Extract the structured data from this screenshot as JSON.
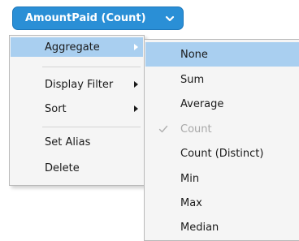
{
  "field_pill": {
    "label": "AmountPaid (Count)",
    "icon": "chevron-down-icon",
    "color": "#2a8fd6"
  },
  "context_menu": {
    "items": [
      {
        "label": "Aggregate",
        "has_submenu": true,
        "active": true
      },
      {
        "label": "Display Filter",
        "has_submenu": true
      },
      {
        "label": "Sort",
        "has_submenu": true
      },
      {
        "label": "Set Alias",
        "has_submenu": false
      },
      {
        "label": "Delete",
        "has_submenu": false
      }
    ]
  },
  "aggregate_submenu": {
    "options": [
      {
        "label": "None",
        "highlighted": true
      },
      {
        "label": "Sum"
      },
      {
        "label": "Average"
      },
      {
        "label": "Count",
        "checked": true,
        "disabled": true
      },
      {
        "label": "Count (Distinct)"
      },
      {
        "label": "Min"
      },
      {
        "label": "Max"
      },
      {
        "label": "Median"
      }
    ],
    "check_icon": "checkmark-icon"
  },
  "colors": {
    "highlight": "#a9cff0",
    "menu_background": "#f5f5f5",
    "disabled_text": "#a8a8a8"
  }
}
